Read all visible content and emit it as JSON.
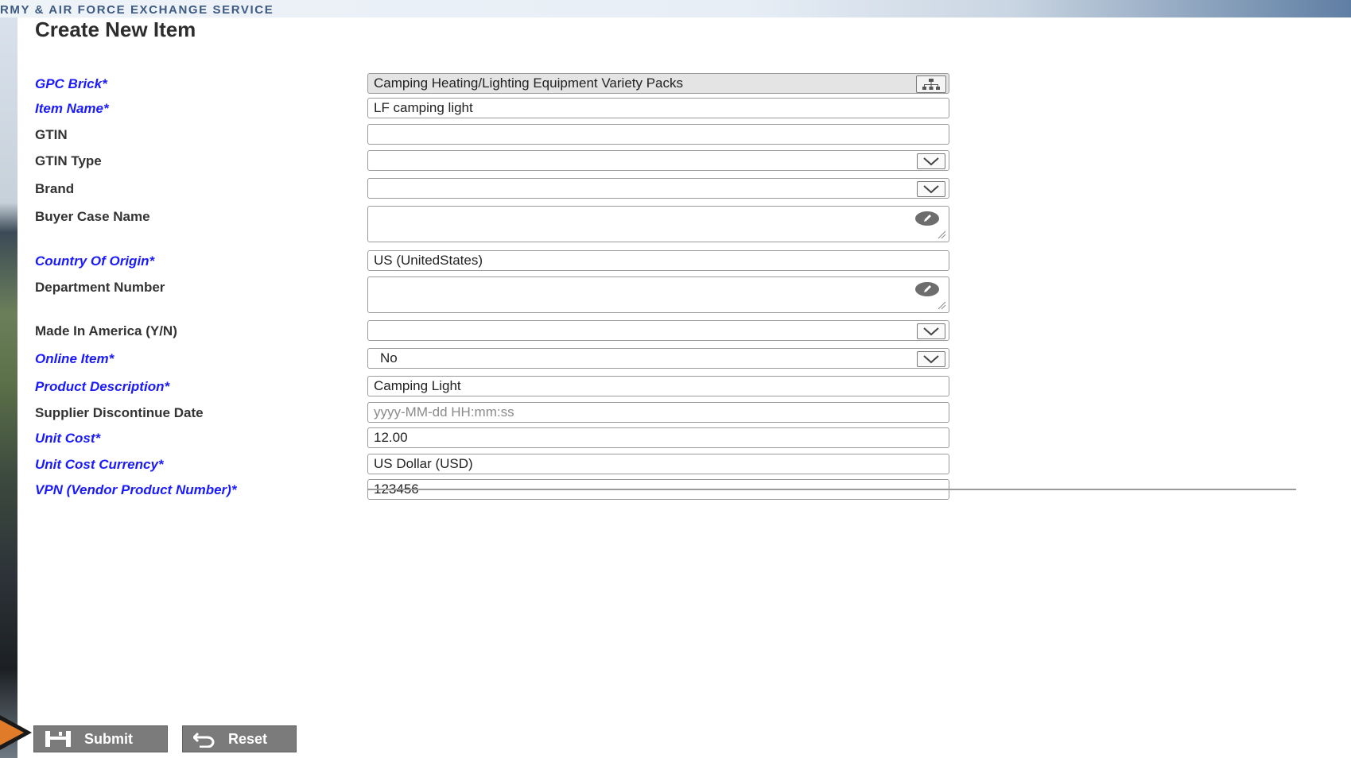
{
  "background": {
    "banner_text": "RMY & AIR FORCE EXCHANGE SERVICE"
  },
  "dialog": {
    "title": "Create New Item"
  },
  "fields": {
    "gpc_brick": {
      "label": "GPC Brick*",
      "value": "Camping Heating/Lighting Equipment Variety Packs"
    },
    "item_name": {
      "label": "Item Name*",
      "value": "LF camping light"
    },
    "gtin": {
      "label": "GTIN",
      "value": ""
    },
    "gtin_type": {
      "label": "GTIN Type",
      "value": ""
    },
    "brand": {
      "label": "Brand",
      "value": ""
    },
    "buyer_case_name": {
      "label": "Buyer Case Name",
      "value": ""
    },
    "country_of_origin": {
      "label": "Country Of Origin*",
      "value": "US (UnitedStates)"
    },
    "department_number": {
      "label": "Department Number",
      "value": ""
    },
    "made_in_america": {
      "label": "Made In America (Y/N)",
      "value": ""
    },
    "online_item": {
      "label": "Online Item*",
      "value": "No"
    },
    "product_description": {
      "label": "Product Description*",
      "value": "Camping Light"
    },
    "supplier_discontinue_date": {
      "label": "Supplier Discontinue Date",
      "value": "",
      "placeholder": "yyyy-MM-dd HH:mm:ss"
    },
    "unit_cost": {
      "label": "Unit Cost*",
      "value": "12.00"
    },
    "unit_cost_currency": {
      "label": "Unit Cost Currency*",
      "value": "US Dollar (USD)"
    },
    "vpn": {
      "label": "VPN (Vendor Product Number)*",
      "value": "123456"
    }
  },
  "buttons": {
    "submit_label": "Submit",
    "reset_label": "Reset"
  },
  "icons": {
    "tree": "hierarchy-tree-icon",
    "dropdown": "chevron-down-icon",
    "edit": "pencil-icon",
    "save": "floppy-disk-icon",
    "reset": "undo-arrow-icon"
  },
  "colors": {
    "required_label": "#1a1aff",
    "label": "#333333",
    "button_bg": "#7b7b7b",
    "pointer_arrow": "#e07b2a"
  }
}
